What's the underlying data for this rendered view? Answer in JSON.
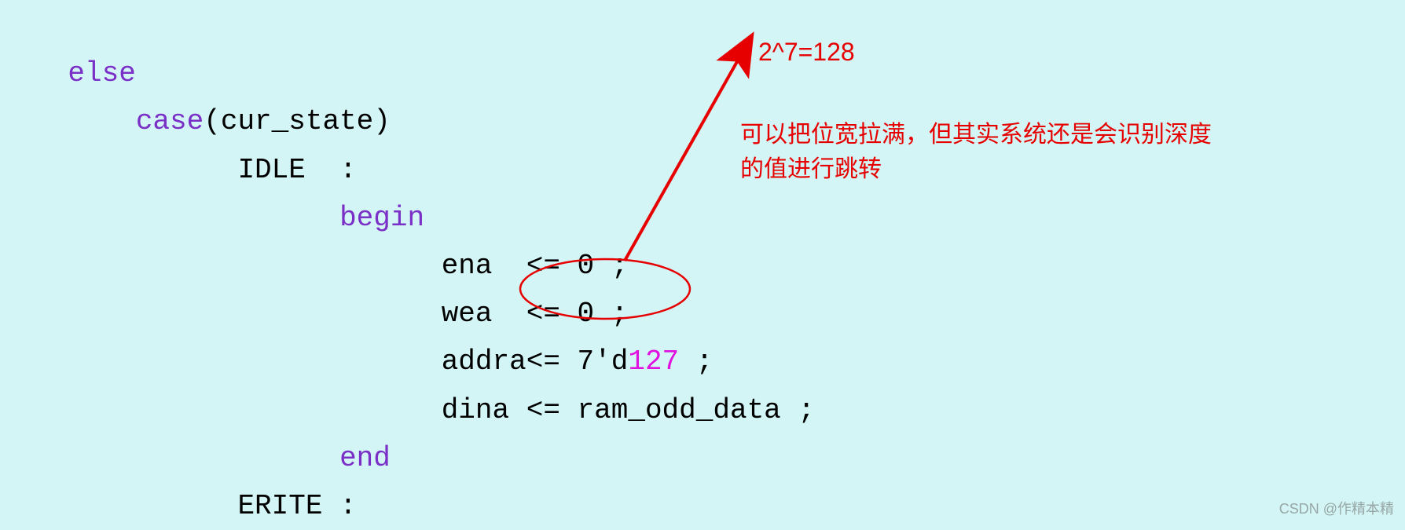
{
  "code": {
    "else_kw": "else",
    "case_kw": "case",
    "case_arg": "(cur_state)",
    "idle_label": "IDLE  :",
    "begin_kw": "begin",
    "line_ena": "ena  <= 0 ;",
    "line_wea": "wea  <= 0 ;",
    "line_addra_a": "addra<= ",
    "line_addra_b": "7'd",
    "line_addra_num": "127",
    "line_addra_c": " ;",
    "line_dina": "dina <= ram_odd_data ;",
    "end_kw": "end",
    "erite_label": "ERITE :"
  },
  "annotations": {
    "top": "2^7=128",
    "block": "可以把位宽拉满，但其实系统还是会识别深度的值进行跳转"
  },
  "watermark": "CSDN @作精本精"
}
